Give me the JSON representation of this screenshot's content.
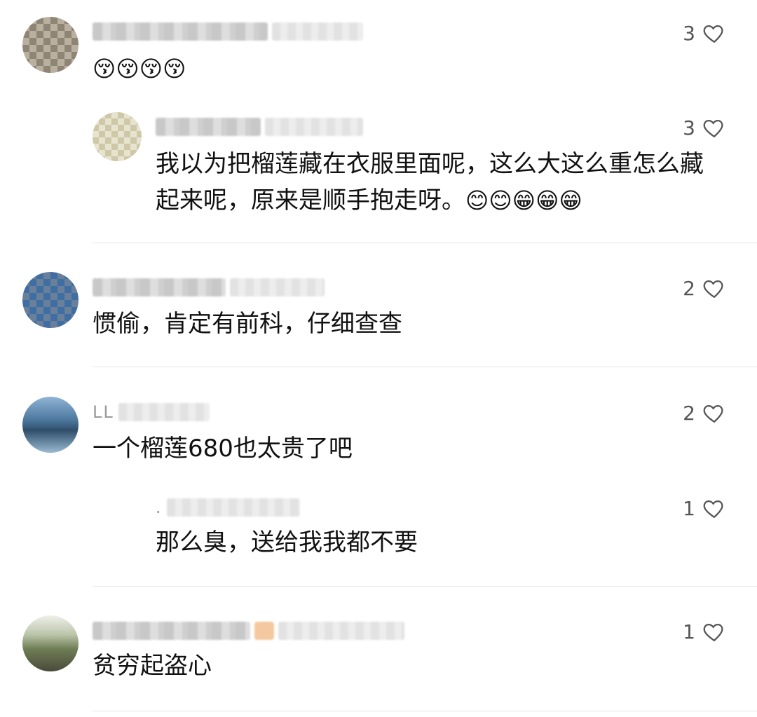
{
  "comments": [
    {
      "user": "",
      "likes": "3",
      "text": "",
      "emoji": "😚😚😚😚"
    },
    {
      "user": "",
      "likes": "3",
      "text": "我以为把榴莲藏在衣服里面呢，这么大这么重怎么藏起来呢，原来是顺手抱走呀。",
      "emoji": "😊😊😁😁😁"
    },
    {
      "user": "",
      "likes": "2",
      "text": "惯偷，肯定有前科，仔细查查"
    },
    {
      "user": "LL",
      "likes": "2",
      "text": "一个榴莲680也太贵了吧"
    },
    {
      "user": ".",
      "likes": "1",
      "text": "那么臭，送给我我都不要"
    },
    {
      "user": "",
      "likes": "1",
      "text": "贫穷起盗心"
    }
  ],
  "icons": {
    "like": "heart-outline-icon"
  },
  "colors": {
    "text": "#111111",
    "meta": "#555555",
    "divider": "#e6e6e6"
  }
}
